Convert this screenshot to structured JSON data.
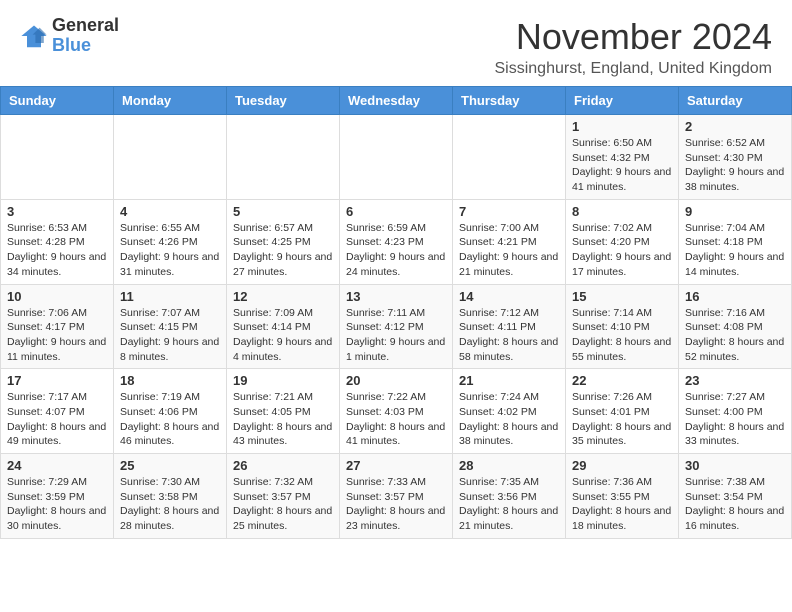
{
  "logo": {
    "general": "General",
    "blue": "Blue"
  },
  "title": "November 2024",
  "location": "Sissinghurst, England, United Kingdom",
  "days_header": [
    "Sunday",
    "Monday",
    "Tuesday",
    "Wednesday",
    "Thursday",
    "Friday",
    "Saturday"
  ],
  "weeks": [
    [
      {
        "day": "",
        "info": ""
      },
      {
        "day": "",
        "info": ""
      },
      {
        "day": "",
        "info": ""
      },
      {
        "day": "",
        "info": ""
      },
      {
        "day": "",
        "info": ""
      },
      {
        "day": "1",
        "info": "Sunrise: 6:50 AM\nSunset: 4:32 PM\nDaylight: 9 hours and 41 minutes."
      },
      {
        "day": "2",
        "info": "Sunrise: 6:52 AM\nSunset: 4:30 PM\nDaylight: 9 hours and 38 minutes."
      }
    ],
    [
      {
        "day": "3",
        "info": "Sunrise: 6:53 AM\nSunset: 4:28 PM\nDaylight: 9 hours and 34 minutes."
      },
      {
        "day": "4",
        "info": "Sunrise: 6:55 AM\nSunset: 4:26 PM\nDaylight: 9 hours and 31 minutes."
      },
      {
        "day": "5",
        "info": "Sunrise: 6:57 AM\nSunset: 4:25 PM\nDaylight: 9 hours and 27 minutes."
      },
      {
        "day": "6",
        "info": "Sunrise: 6:59 AM\nSunset: 4:23 PM\nDaylight: 9 hours and 24 minutes."
      },
      {
        "day": "7",
        "info": "Sunrise: 7:00 AM\nSunset: 4:21 PM\nDaylight: 9 hours and 21 minutes."
      },
      {
        "day": "8",
        "info": "Sunrise: 7:02 AM\nSunset: 4:20 PM\nDaylight: 9 hours and 17 minutes."
      },
      {
        "day": "9",
        "info": "Sunrise: 7:04 AM\nSunset: 4:18 PM\nDaylight: 9 hours and 14 minutes."
      }
    ],
    [
      {
        "day": "10",
        "info": "Sunrise: 7:06 AM\nSunset: 4:17 PM\nDaylight: 9 hours and 11 minutes."
      },
      {
        "day": "11",
        "info": "Sunrise: 7:07 AM\nSunset: 4:15 PM\nDaylight: 9 hours and 8 minutes."
      },
      {
        "day": "12",
        "info": "Sunrise: 7:09 AM\nSunset: 4:14 PM\nDaylight: 9 hours and 4 minutes."
      },
      {
        "day": "13",
        "info": "Sunrise: 7:11 AM\nSunset: 4:12 PM\nDaylight: 9 hours and 1 minute."
      },
      {
        "day": "14",
        "info": "Sunrise: 7:12 AM\nSunset: 4:11 PM\nDaylight: 8 hours and 58 minutes."
      },
      {
        "day": "15",
        "info": "Sunrise: 7:14 AM\nSunset: 4:10 PM\nDaylight: 8 hours and 55 minutes."
      },
      {
        "day": "16",
        "info": "Sunrise: 7:16 AM\nSunset: 4:08 PM\nDaylight: 8 hours and 52 minutes."
      }
    ],
    [
      {
        "day": "17",
        "info": "Sunrise: 7:17 AM\nSunset: 4:07 PM\nDaylight: 8 hours and 49 minutes."
      },
      {
        "day": "18",
        "info": "Sunrise: 7:19 AM\nSunset: 4:06 PM\nDaylight: 8 hours and 46 minutes."
      },
      {
        "day": "19",
        "info": "Sunrise: 7:21 AM\nSunset: 4:05 PM\nDaylight: 8 hours and 43 minutes."
      },
      {
        "day": "20",
        "info": "Sunrise: 7:22 AM\nSunset: 4:03 PM\nDaylight: 8 hours and 41 minutes."
      },
      {
        "day": "21",
        "info": "Sunrise: 7:24 AM\nSunset: 4:02 PM\nDaylight: 8 hours and 38 minutes."
      },
      {
        "day": "22",
        "info": "Sunrise: 7:26 AM\nSunset: 4:01 PM\nDaylight: 8 hours and 35 minutes."
      },
      {
        "day": "23",
        "info": "Sunrise: 7:27 AM\nSunset: 4:00 PM\nDaylight: 8 hours and 33 minutes."
      }
    ],
    [
      {
        "day": "24",
        "info": "Sunrise: 7:29 AM\nSunset: 3:59 PM\nDaylight: 8 hours and 30 minutes."
      },
      {
        "day": "25",
        "info": "Sunrise: 7:30 AM\nSunset: 3:58 PM\nDaylight: 8 hours and 28 minutes."
      },
      {
        "day": "26",
        "info": "Sunrise: 7:32 AM\nSunset: 3:57 PM\nDaylight: 8 hours and 25 minutes."
      },
      {
        "day": "27",
        "info": "Sunrise: 7:33 AM\nSunset: 3:57 PM\nDaylight: 8 hours and 23 minutes."
      },
      {
        "day": "28",
        "info": "Sunrise: 7:35 AM\nSunset: 3:56 PM\nDaylight: 8 hours and 21 minutes."
      },
      {
        "day": "29",
        "info": "Sunrise: 7:36 AM\nSunset: 3:55 PM\nDaylight: 8 hours and 18 minutes."
      },
      {
        "day": "30",
        "info": "Sunrise: 7:38 AM\nSunset: 3:54 PM\nDaylight: 8 hours and 16 minutes."
      }
    ]
  ]
}
